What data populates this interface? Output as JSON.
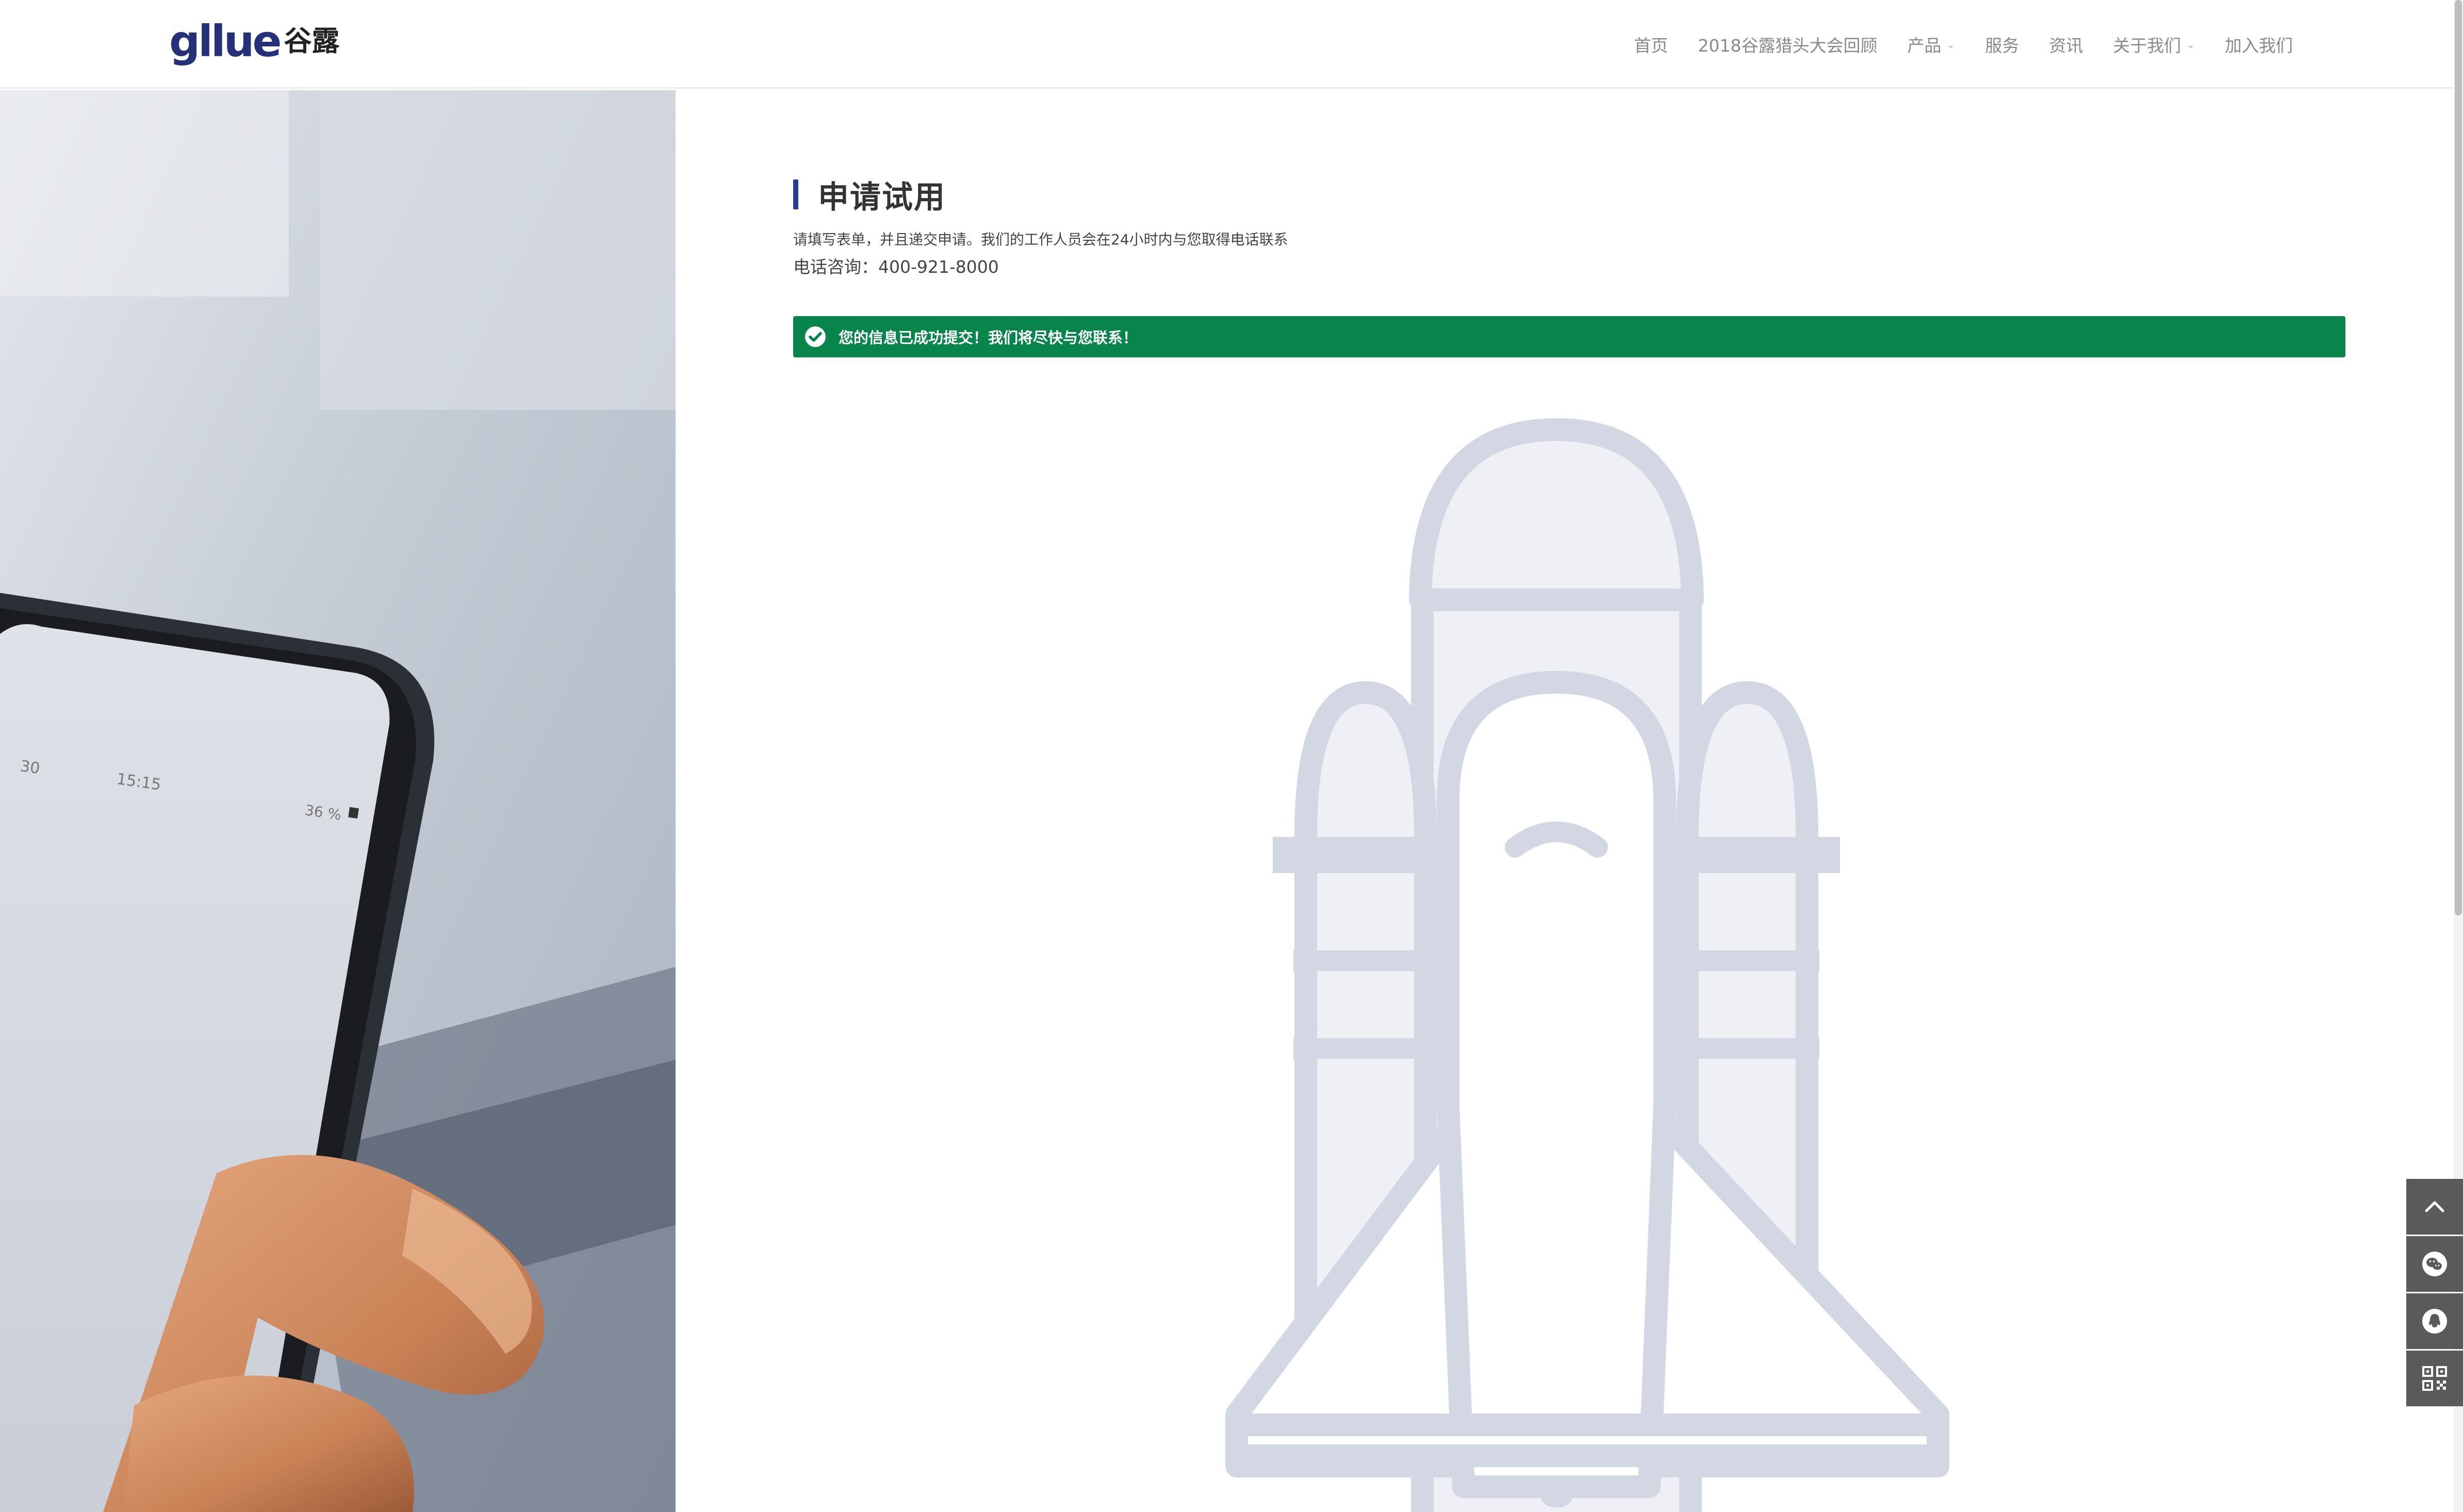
{
  "header": {
    "logo": {
      "brand_en": "gllue",
      "brand_zh": "谷露"
    },
    "nav": [
      {
        "label": "首页"
      },
      {
        "label": "2018谷露猎头大会回顾"
      },
      {
        "label": "产品",
        "has_dropdown": true
      },
      {
        "label": "服务"
      },
      {
        "label": "资讯"
      },
      {
        "label": "关于我们",
        "has_dropdown": true
      },
      {
        "label": "加入我们"
      }
    ]
  },
  "hero_photo": {
    "phone_status": {
      "time": "15:15",
      "carrier": "30",
      "battery": "36 %"
    }
  },
  "main": {
    "title": "申请试用",
    "intro": "请填写表单，并且递交申请。我们的工作人员会在24小时内与您取得电话联系",
    "phone_label": "电话咨询：",
    "phone_number": "400-921-8000",
    "alert": {
      "text": "您的信息已成功提交！我们将尽快与您联系！",
      "icon": "check-circle-icon"
    }
  },
  "side_toolbar": [
    {
      "icon": "chevron-up-icon",
      "label": "back-to-top"
    },
    {
      "icon": "wechat-icon",
      "label": "wechat"
    },
    {
      "icon": "qq-icon",
      "label": "qq"
    },
    {
      "icon": "qr-code-icon",
      "label": "qr-code"
    }
  ],
  "colors": {
    "brand": "#24307a",
    "accent_bar": "#2b3a8f",
    "success": "#08854b",
    "rocket": "#d2d7e3",
    "rocket_fill": "#eef0f5",
    "toolbar": "#5a5a5a"
  }
}
